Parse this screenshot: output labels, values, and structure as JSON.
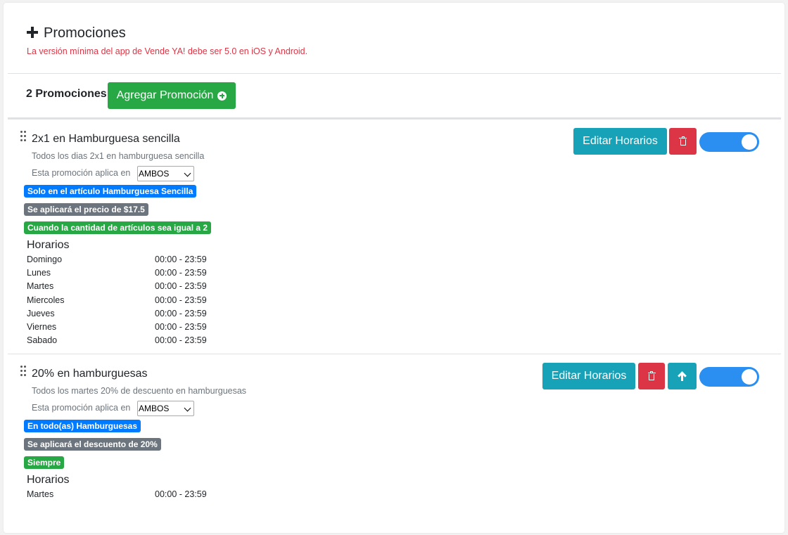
{
  "header": {
    "title": "Promociones",
    "warning": "La versión mínima del app de Vende YA! debe ser 5.0 en iOS y Android."
  },
  "toolbar": {
    "count_label": "2 Promociones",
    "add_button": "Agregar Promoción"
  },
  "promotions": [
    {
      "title": "2x1 en Hamburguesa sencilla",
      "description": "Todos los dias 2x1 en hamburguesa sencilla",
      "applies_label": "Esta promoción aplica en",
      "applies_value": "AMBOS",
      "badges": [
        {
          "text": "Solo en el artículo Hamburguesa Sencilla",
          "color": "#007bff"
        },
        {
          "text": "Se aplicará el precio de $17.5",
          "color": "#6c757d"
        },
        {
          "text": "Cuando la cantidad de artículos sea igual a 2",
          "color": "#28a745"
        }
      ],
      "horarios_title": "Horarios",
      "schedule": [
        {
          "day": "Domingo",
          "time": "00:00 - 23:59"
        },
        {
          "day": "Lunes",
          "time": "00:00 - 23:59"
        },
        {
          "day": "Martes",
          "time": "00:00 - 23:59"
        },
        {
          "day": "Miercoles",
          "time": "00:00 - 23:59"
        },
        {
          "day": "Jueves",
          "time": "00:00 - 23:59"
        },
        {
          "day": "Viernes",
          "time": "00:00 - 23:59"
        },
        {
          "day": "Sabado",
          "time": "00:00 - 23:59"
        }
      ],
      "edit_button": "Editar Horarios",
      "enabled": true
    },
    {
      "title": "20% en hamburguesas",
      "description": "Todos los martes 20% de descuento en hamburguesas",
      "applies_label": "Esta promoción aplica en",
      "applies_value": "AMBOS",
      "badges": [
        {
          "text": "En todo(as) Hamburguesas",
          "color": "#007bff"
        },
        {
          "text": "Se aplicará el descuento de 20%",
          "color": "#6c757d"
        },
        {
          "text": "Siempre",
          "color": "#28a745"
        }
      ],
      "horarios_title": "Horarios",
      "schedule": [
        {
          "day": "Martes",
          "time": "00:00 - 23:59"
        }
      ],
      "edit_button": "Editar Horarios",
      "enabled": true
    }
  ],
  "colors": {
    "accent_green": "#28a745",
    "teal": "#17a2b8",
    "danger": "#dc3545",
    "toggle_on": "#2a8ff0"
  }
}
